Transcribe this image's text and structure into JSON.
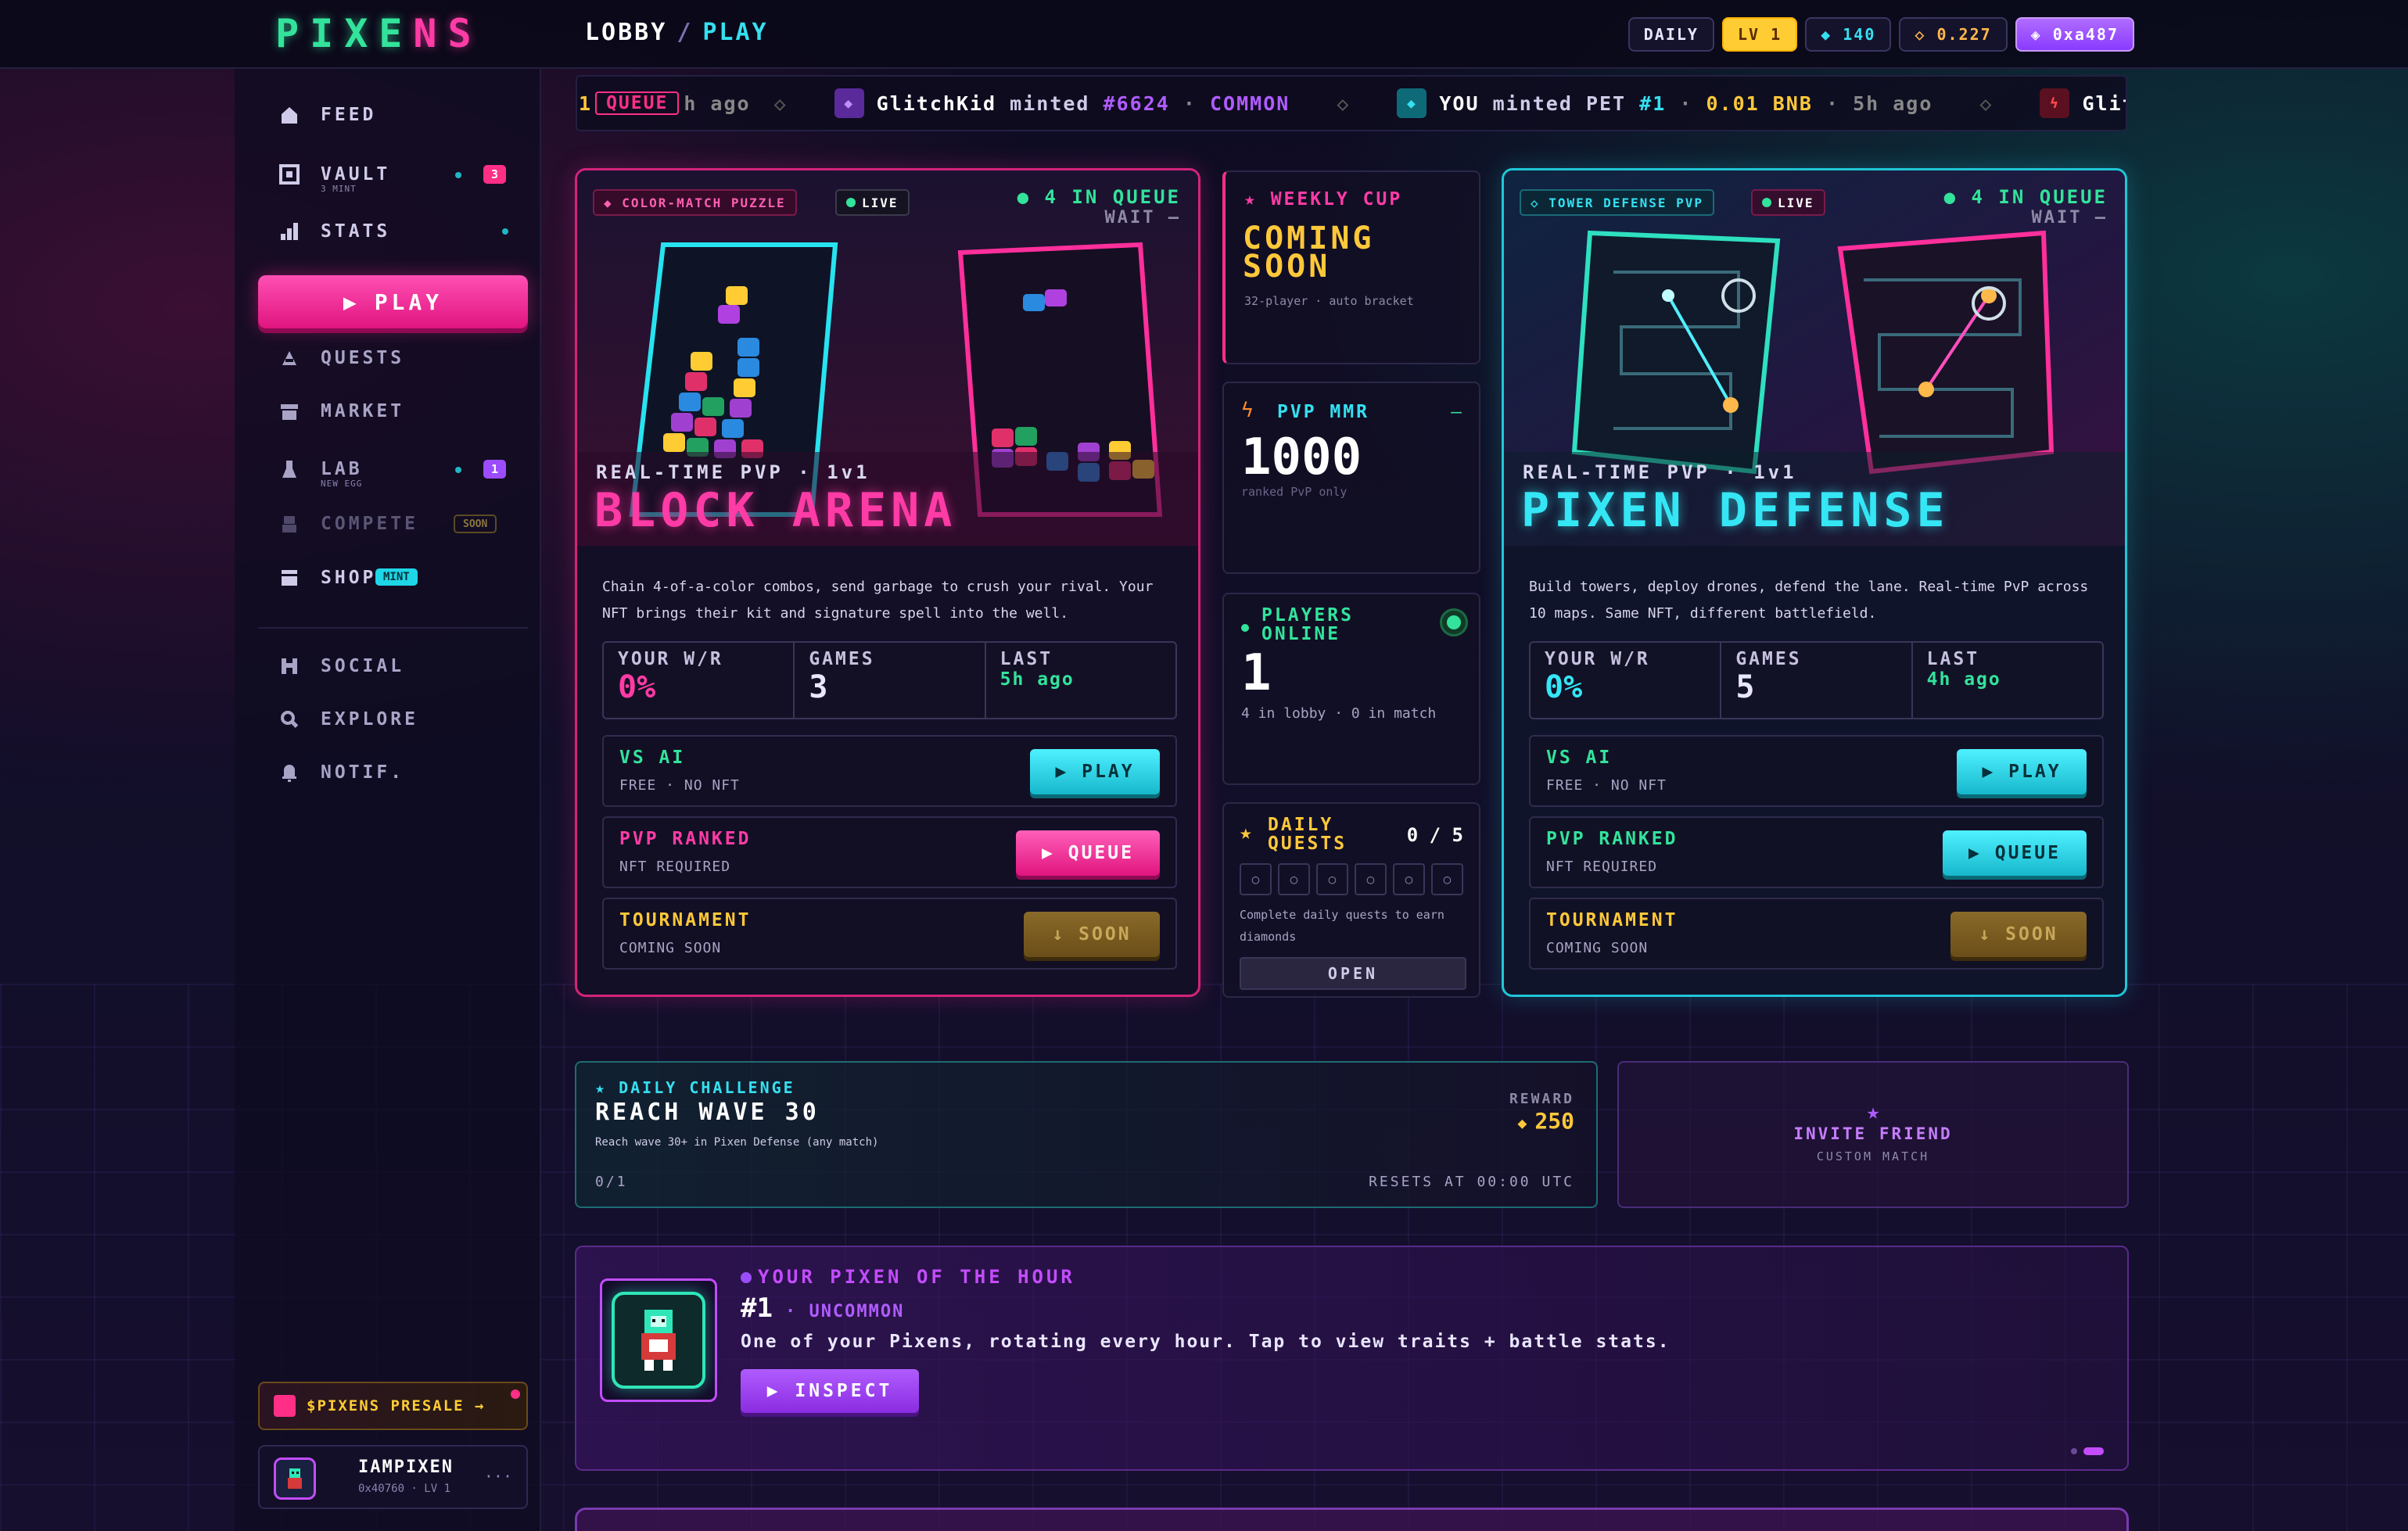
{
  "header": {
    "logo": "PIXENS",
    "breadcrumb": {
      "root": "LOBBY",
      "sep": "/",
      "current": "PLAY"
    },
    "chips": {
      "daily": "DAILY",
      "level": "LV 1",
      "gems": "◆ 140",
      "coins": "◇ 0.227",
      "wallet": "◈ 0xa487"
    }
  },
  "sidebar": {
    "items": [
      {
        "label": "FEED",
        "icon": "home-icon"
      },
      {
        "label": "VAULT",
        "sub": "3 MINT",
        "badge": "3",
        "icon": "vault-icon"
      },
      {
        "label": "STATS",
        "icon": "stats-icon"
      },
      {
        "label": "QUESTS",
        "icon": "quests-icon"
      },
      {
        "label": "MARKET",
        "icon": "market-icon"
      },
      {
        "label": "LAB",
        "sub": "NEW EGG",
        "badge": "1",
        "icon": "lab-icon"
      },
      {
        "label": "COMPETE",
        "badge": "SOON",
        "icon": "compete-icon"
      },
      {
        "label": "SHOP",
        "badge": "MINT",
        "icon": "shop-icon"
      },
      {
        "label": "SOCIAL",
        "icon": "social-icon"
      },
      {
        "label": "EXPLORE",
        "icon": "explore-icon"
      },
      {
        "label": "NOTIF.",
        "icon": "bell-icon"
      }
    ],
    "play_label": "PLAY",
    "presale": "$PIXENS PRESALE →",
    "user": {
      "name": "IAMPIXEN",
      "meta": "0x40760 · LV 1",
      "menu": "···"
    }
  },
  "ticker": {
    "lead": "1",
    "lead_badge": "QUEUE",
    "lead_tail": "h ago",
    "item1": {
      "user": "GlitchKid",
      "verb": "minted",
      "id": "#6624",
      "rarity": "COMMON"
    },
    "item2": {
      "user": "YOU",
      "verb": "minted PET",
      "id": "#1",
      "price": "0.01 BNB",
      "time": "5h ago"
    },
    "item3": {
      "user": "Glitc"
    },
    "dot": "·",
    "diamond": "◇"
  },
  "games": {
    "block": {
      "tag": "◆ COLOR-MATCH PUZZLE",
      "live": "LIVE",
      "queue": "● 4 IN QUEUE",
      "wait": "WAIT —",
      "subtitle": "REAL-TIME PVP · 1v1",
      "title": "BLOCK ARENA",
      "desc": "Chain 4-of-a-color combos, send garbage to crush your rival. Your NFT brings their kit and signature spell into the well.",
      "stats": [
        {
          "k": "YOUR W/R",
          "v": "0%"
        },
        {
          "k": "GAMES",
          "v": "3"
        },
        {
          "k": "LAST",
          "v": "5h ago"
        }
      ],
      "modes": [
        {
          "t": "VS AI",
          "s": "FREE · NO NFT",
          "btn": "▶ PLAY"
        },
        {
          "t": "PVP RANKED",
          "s": "NFT REQUIRED",
          "btn": "▶ QUEUE"
        },
        {
          "t": "TOURNAMENT",
          "s": "COMING SOON",
          "btn": "↓ SOON"
        }
      ]
    },
    "defense": {
      "tag": "◇ TOWER DEFENSE PVP",
      "live": "LIVE",
      "queue": "● 4 IN QUEUE",
      "wait": "WAIT —",
      "subtitle": "REAL-TIME PVP · 1v1",
      "title": "PIXEN DEFENSE",
      "desc": "Build towers, deploy drones, defend the lane. Real-time PvP across 10 maps. Same NFT, different battlefield.",
      "stats": [
        {
          "k": "YOUR W/R",
          "v": "0%"
        },
        {
          "k": "GAMES",
          "v": "5"
        },
        {
          "k": "LAST",
          "v": "4h ago"
        }
      ],
      "modes": [
        {
          "t": "VS AI",
          "s": "FREE · NO NFT",
          "btn": "▶ PLAY"
        },
        {
          "t": "PVP RANKED",
          "s": "NFT REQUIRED",
          "btn": "▶ QUEUE"
        },
        {
          "t": "TOURNAMENT",
          "s": "COMING SOON",
          "btn": "↓ SOON"
        }
      ]
    }
  },
  "middle": {
    "cup": {
      "label": "★ WEEKLY CUP",
      "status1": "COMING",
      "status2": "SOON",
      "sub": "32-player · auto bracket"
    },
    "mmr": {
      "label": "PVP MMR",
      "dash": "—",
      "value": "1000",
      "sub": "ranked PvP only"
    },
    "online": {
      "label1": "PLAYERS",
      "label2": "ONLINE",
      "value": "1",
      "sub": "4 in lobby · 0 in match"
    },
    "quests": {
      "label1": "DAILY",
      "label2": "QUESTS",
      "count": "0 / 5",
      "desc": "Complete daily quests to earn diamonds",
      "btn": "OPEN",
      "slots": [
        "○",
        "○",
        "○",
        "○",
        "○",
        "○"
      ]
    }
  },
  "challenge": {
    "tag": "★ DAILY CHALLENGE",
    "title": "REACH WAVE 30",
    "desc": "Reach wave 30+ in Pixen Defense (any match)",
    "reward_label": "REWARD",
    "reward": "250",
    "progress": "0/1",
    "resets": "RESETS AT 00:00 UTC"
  },
  "invite": {
    "star": "★",
    "title": "INVITE FRIEND",
    "sub": "CUSTOM MATCH"
  },
  "pixen": {
    "label": "YOUR PIXEN OF THE HOUR",
    "id": "#1",
    "rarity": "· UNCOMMON",
    "desc": "One of your Pixens, rotating every hour. Tap to view traits + battle stats.",
    "btn": "▶ INSPECT"
  },
  "colors": {
    "pink": "#ff2f9b",
    "cyan": "#29e6f5",
    "gold": "#ffc83a",
    "green": "#33e39b",
    "purple": "#b05cff"
  }
}
